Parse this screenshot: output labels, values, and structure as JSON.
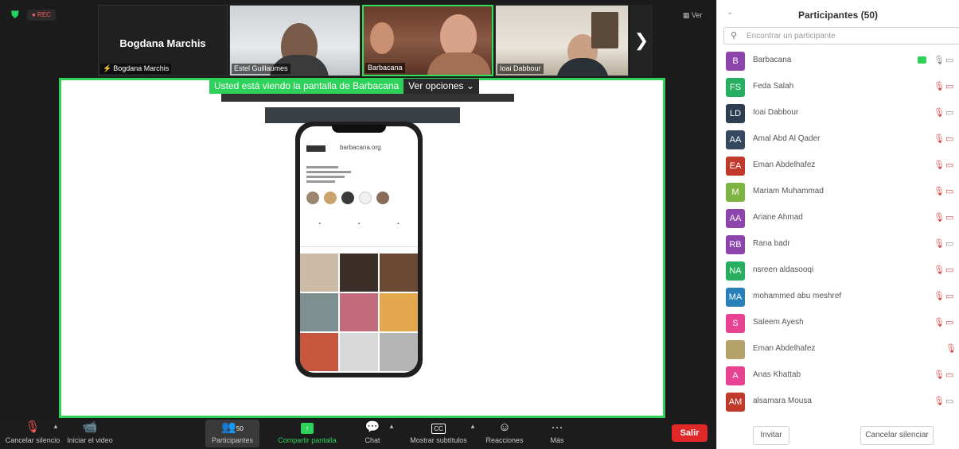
{
  "recording": {
    "label": "● REC"
  },
  "top": {
    "speaker_big_name": "Bogdana Marchis",
    "tiles": [
      {
        "label": "Bogdana Marchis"
      },
      {
        "label": "Estel Guillaumes"
      },
      {
        "label": "Barbacana"
      },
      {
        "label": "Ioai Dabbour"
      }
    ],
    "next_arrow": "❯",
    "view_button": "▦ Ver"
  },
  "share_banner": {
    "text": "Usted está viendo la pantalla de Barbacana",
    "options": "Ver opciones ⌄"
  },
  "shared_content": {
    "ig_handle": "barbacana.org"
  },
  "toolbar": {
    "mute": "Cancelar silencio",
    "video": "Iniciar el video",
    "participants": "Participantes",
    "participants_count": "50",
    "share": "Compartir pantalla",
    "chat": "Chat",
    "captions": "Mostrar subtítulos",
    "reactions": "Reacciones",
    "more": "Más",
    "leave": "Salir"
  },
  "panel": {
    "title": "Participantes (50)",
    "search_placeholder": "Encontrar un participante",
    "participants": [
      {
        "initials": "B",
        "name": "Barbacana",
        "color": "#8e44ad",
        "mic_on": true,
        "cam_on": true,
        "sharing": true
      },
      {
        "initials": "FS",
        "name": "Feda Salah",
        "color": "#27ae60",
        "mic_on": false,
        "cam_on": false
      },
      {
        "initials": "LD",
        "name": "Ioai Dabbour",
        "color": "#2c3e50",
        "mic_on": false,
        "cam_on": true
      },
      {
        "initials": "AA",
        "name": "Amal Abd Al Qader",
        "color": "#34495e",
        "mic_on": false,
        "cam_on": false
      },
      {
        "initials": "EA",
        "name": "Eman Abdelhafez",
        "color": "#c0392b",
        "mic_on": false,
        "cam_on": false
      },
      {
        "initials": "M",
        "name": "Mariam Muhammad",
        "color": "#7cb342",
        "mic_on": false,
        "cam_on": false
      },
      {
        "initials": "AA",
        "name": "Ariane Ahmad",
        "color": "#8e44ad",
        "mic_on": false,
        "cam_on": false
      },
      {
        "initials": "RB",
        "name": "Rana badr",
        "color": "#8e44ad",
        "mic_on": false,
        "cam_on": true
      },
      {
        "initials": "NA",
        "name": "nsreen aldasooqi",
        "color": "#27ae60",
        "mic_on": false,
        "cam_on": false
      },
      {
        "initials": "MA",
        "name": "mohammed abu meshref",
        "color": "#2980b9",
        "mic_on": false,
        "cam_on": false
      },
      {
        "initials": "S",
        "name": "Saleem Ayesh",
        "color": "#e84393",
        "mic_on": false,
        "cam_on": false
      },
      {
        "initials": "",
        "name": "Eman Abdelhafez",
        "color": "#b5a26a",
        "mic_on": false,
        "cam_on": null
      },
      {
        "initials": "A",
        "name": "Anas Khattab",
        "color": "#e84393",
        "mic_on": false,
        "cam_on": false
      },
      {
        "initials": "AM",
        "name": "alsamara Mousa",
        "color": "#c0392b",
        "mic_on": false,
        "cam_on": true
      }
    ],
    "invite": "Invitar",
    "unmute_all": "Cancelar silenciar"
  }
}
